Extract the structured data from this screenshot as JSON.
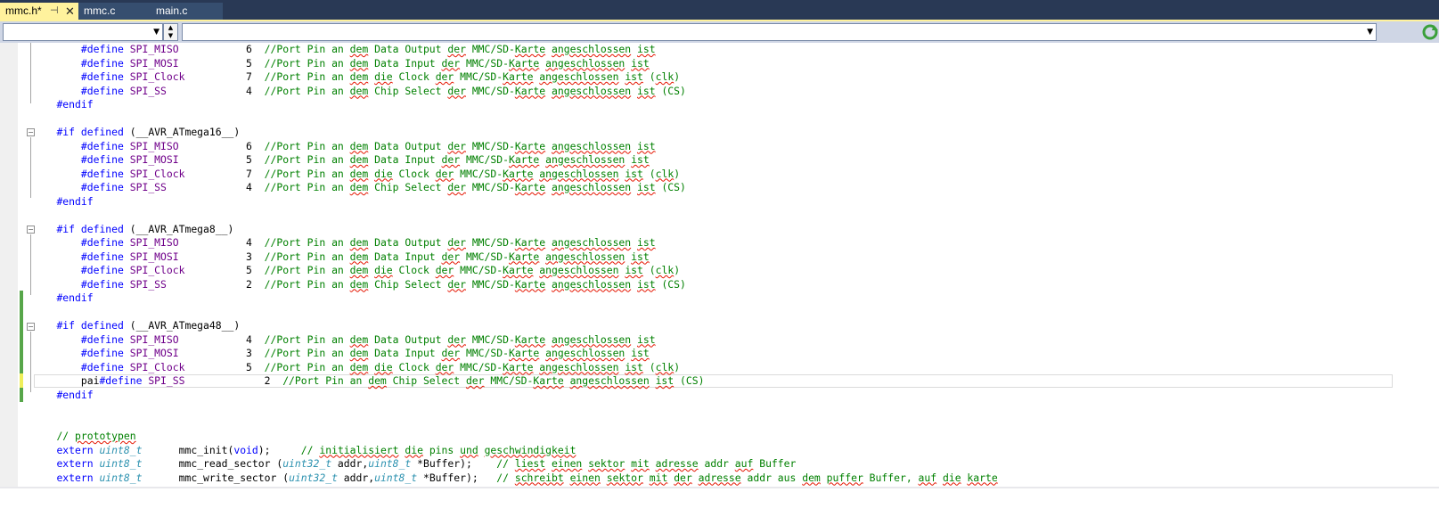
{
  "tabs": [
    {
      "label": "mmc.h*",
      "active": true,
      "pin": "⊣",
      "close": "✕"
    },
    {
      "label": "mmc.c",
      "active": false
    },
    {
      "label": "main.c",
      "active": false
    }
  ],
  "navbar": {
    "left_value": "",
    "right_value": ""
  },
  "colors": {
    "keyword": "#0000ff",
    "comment": "#008000",
    "macro": "#6f008a",
    "type": "#2b91af",
    "tab_active": "#fff29d",
    "title_bg": "#293955"
  },
  "code": {
    "l1": "        #define SPI_MISO           6  //Port Pin an dem Data Output der MMC/SD-Karte angeschlossen ist",
    "l2": "        #define SPI_MOSI           5  //Port Pin an dem Data Input der MMC/SD-Karte angeschlossen ist",
    "l3": "        #define SPI_Clock          7  //Port Pin an dem die Clock der MMC/SD-Karte angeschlossen ist (clk)",
    "l4": "        #define SPI_SS             4  //Port Pin an dem Chip Select der MMC/SD-Karte angeschlossen ist (CS)",
    "l5": "    #endif",
    "l6": "",
    "l7": "    #if defined (__AVR_ATmega16__)",
    "l8": "        #define SPI_MISO           6  //Port Pin an dem Data Output der MMC/SD-Karte angeschlossen ist",
    "l9": "        #define SPI_MOSI           5  //Port Pin an dem Data Input der MMC/SD-Karte angeschlossen ist",
    "l10": "        #define SPI_Clock          7  //Port Pin an dem die Clock der MMC/SD-Karte angeschlossen ist (clk)",
    "l11": "        #define SPI_SS             4  //Port Pin an dem Chip Select der MMC/SD-Karte angeschlossen ist (CS)",
    "l12": "    #endif",
    "l13": "",
    "l14": "    #if defined (__AVR_ATmega8__)",
    "l15": "        #define SPI_MISO           4  //Port Pin an dem Data Output der MMC/SD-Karte angeschlossen ist",
    "l16": "        #define SPI_MOSI           3  //Port Pin an dem Data Input der MMC/SD-Karte angeschlossen ist",
    "l17": "        #define SPI_Clock          5  //Port Pin an dem die Clock der MMC/SD-Karte angeschlossen ist (clk)",
    "l18": "        #define SPI_SS             2  //Port Pin an dem Chip Select der MMC/SD-Karte angeschlossen ist (CS)",
    "l19": "    #endif",
    "l20": "",
    "l21": "    #if defined (__AVR_ATmega48__)",
    "l22": "        #define SPI_MISO           4  //Port Pin an dem Data Output der MMC/SD-Karte angeschlossen ist",
    "l23": "        #define SPI_MOSI           3  //Port Pin an dem Data Input der MMC/SD-Karte angeschlossen ist",
    "l24": "        #define SPI_Clock          5  //Port Pin an dem die Clock der MMC/SD-Karte angeschlossen ist (clk)",
    "l25": "        pai#define SPI_SS             2  //Port Pin an dem Chip Select der MMC/SD-Karte angeschlossen ist (CS)",
    "l26": "    #endif",
    "l27": "",
    "l28": "",
    "l29": "    // prototypen",
    "l30": "    extern uint8_t      mmc_init(void);     // initialisiert die pins und geschwindigkeit",
    "l31": "    extern uint8_t      mmc_read_sector (uint32_t addr,uint8_t *Buffer);    // liest einen sektor mit adresse addr auf Buffer",
    "l32": "    extern uint8_t      mmc_write_sector (uint32_t addr,uint8_t *Buffer);   // schreibt einen sektor mit der adresse addr aus dem puffer Buffer, auf die karte"
  }
}
